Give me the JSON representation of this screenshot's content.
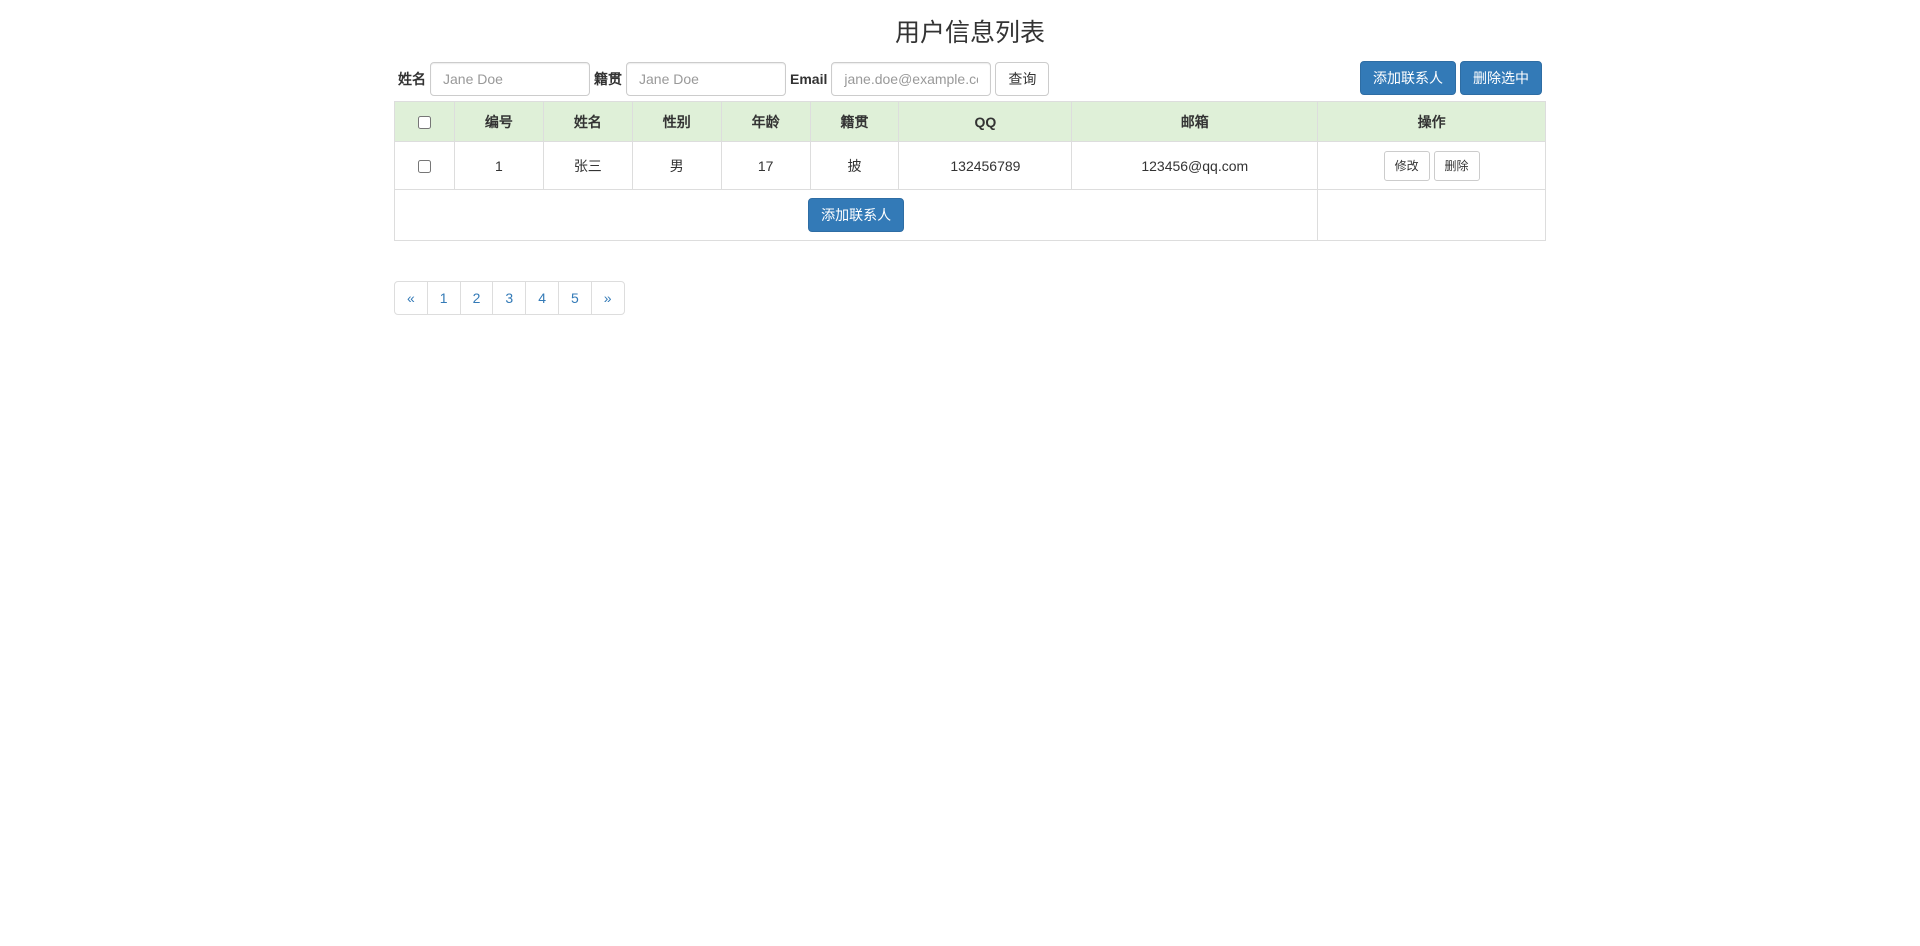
{
  "page": {
    "title": "用户信息列表"
  },
  "search": {
    "name_label": "姓名",
    "name_placeholder": "Jane Doe",
    "name_value": "",
    "origin_label": "籍贯",
    "origin_placeholder": "Jane Doe",
    "origin_value": "",
    "email_label": "Email",
    "email_placeholder": "jane.doe@example.com",
    "email_value": "",
    "query_button": "查询"
  },
  "actions": {
    "add_contact": "添加联系人",
    "delete_selected": "删除选中"
  },
  "table": {
    "headers": [
      "编号",
      "姓名",
      "性别",
      "年龄",
      "籍贯",
      "QQ",
      "邮箱",
      "操作"
    ],
    "rows": [
      {
        "checked": false,
        "id": "1",
        "name": "张三",
        "gender": "男",
        "age": "17",
        "origin": "披",
        "qq": "132456789",
        "email": "123456@qq.com",
        "edit_label": "修改",
        "delete_label": "删除"
      }
    ],
    "footer_add_button": "添加联系人"
  },
  "pagination": {
    "prev": "«",
    "pages": [
      "1",
      "2",
      "3",
      "4",
      "5"
    ],
    "next": "»"
  },
  "colors": {
    "primary": "#337ab7",
    "header_bg": "#dff0d8",
    "border": "#dddddd"
  }
}
